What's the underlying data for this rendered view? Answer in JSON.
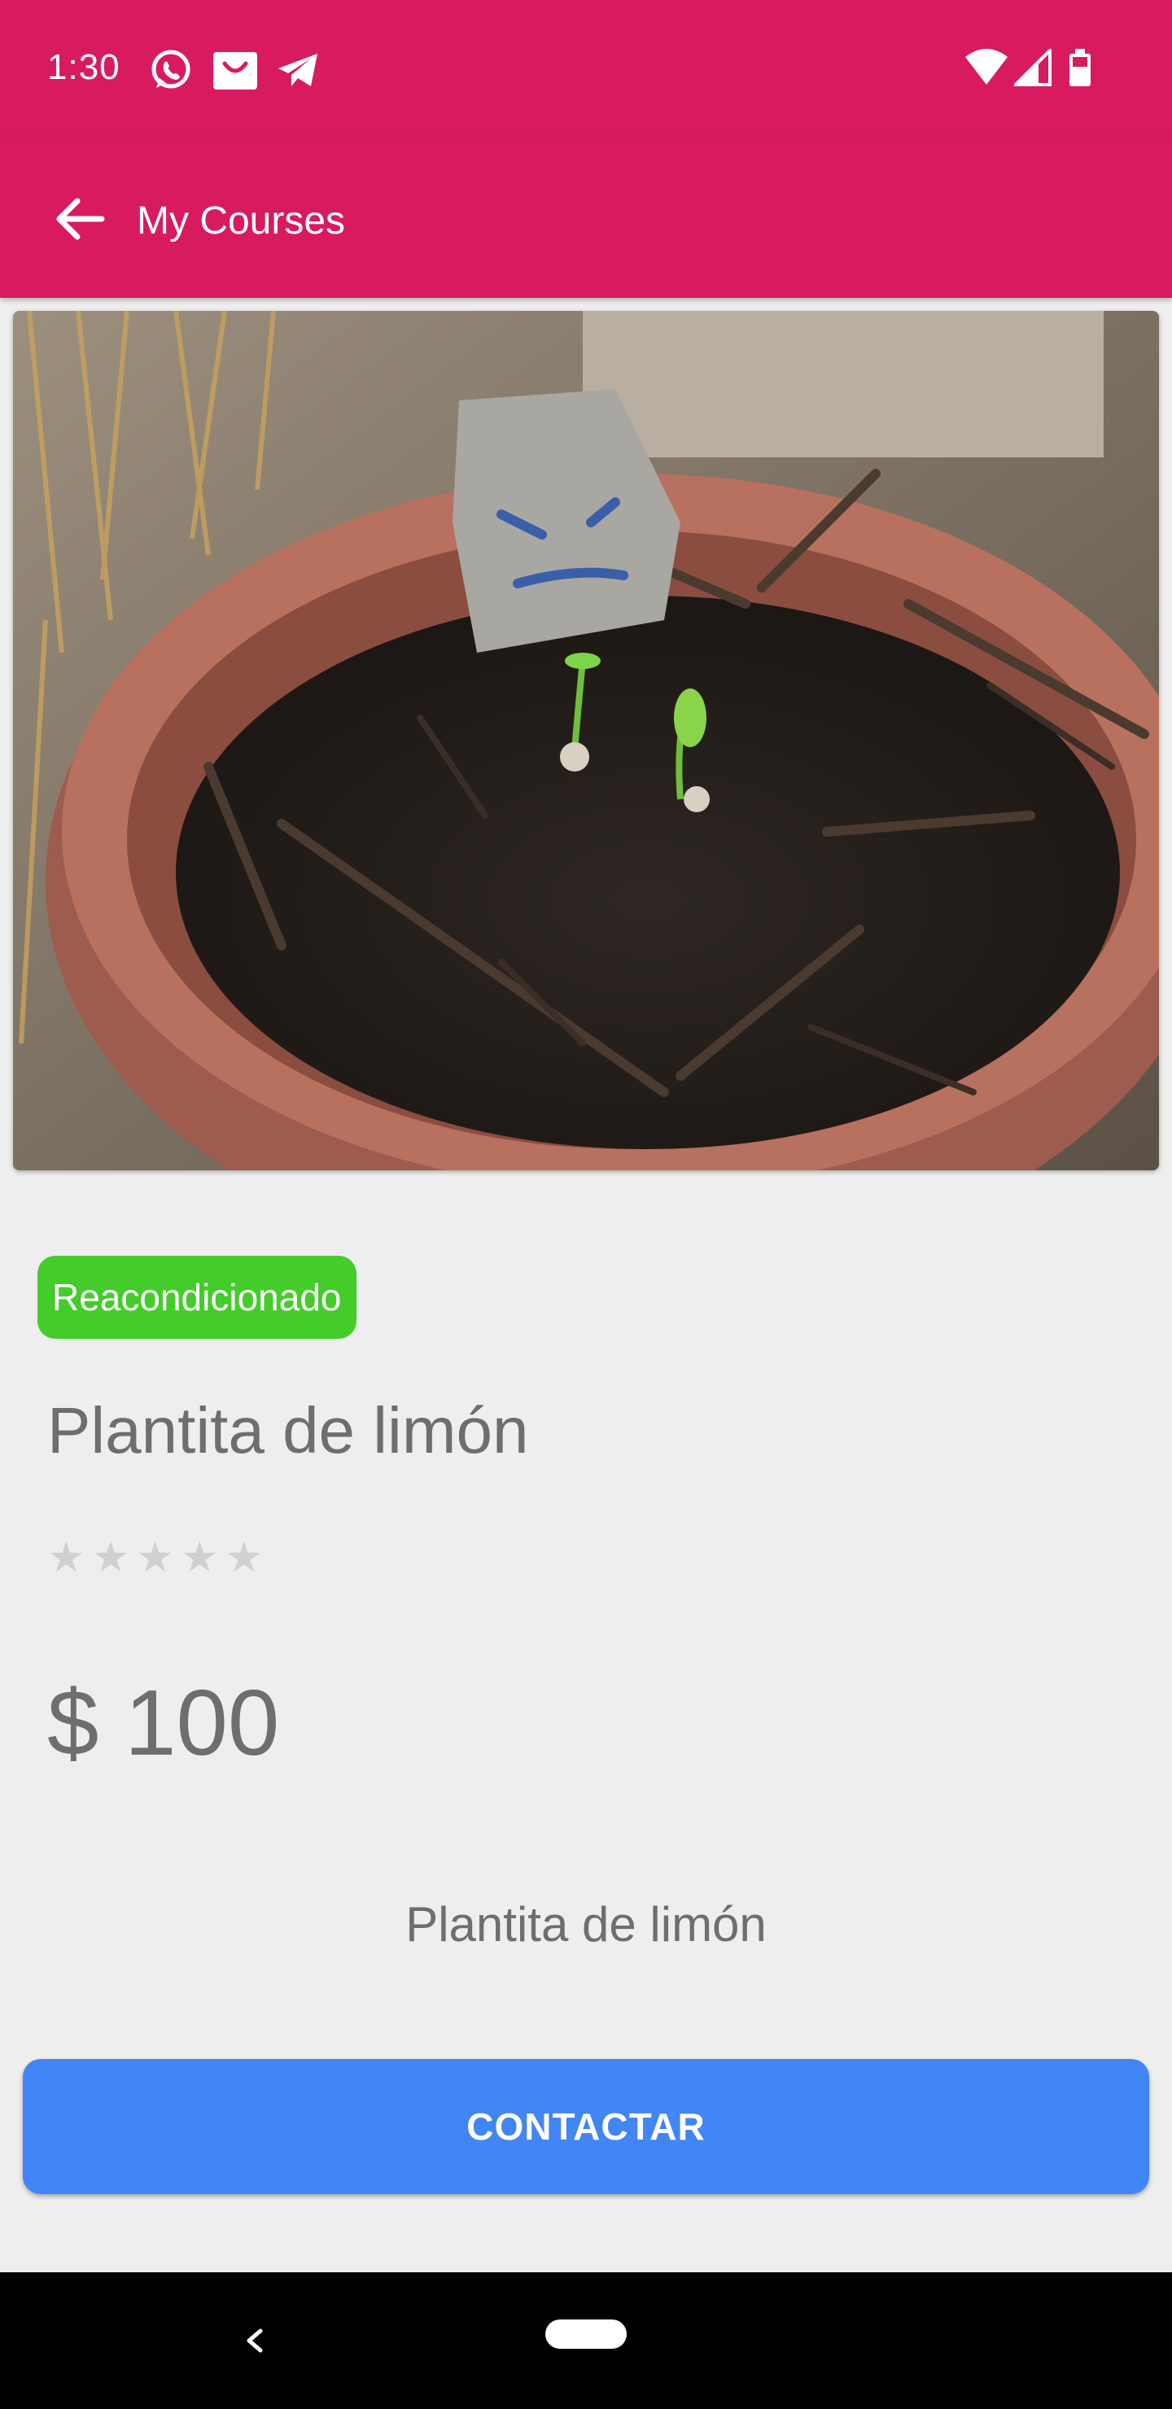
{
  "status_bar": {
    "time": "1:30",
    "left_icons": [
      "whatsapp-icon",
      "bag-icon",
      "telegram-icon"
    ],
    "right_icons": [
      "wifi-icon",
      "signal-icon",
      "battery-icon"
    ]
  },
  "app_bar": {
    "back_icon": "arrow-back-icon",
    "title": "My Courses",
    "color": "#d81b60"
  },
  "product": {
    "image_alt": "potted lemon seedlings",
    "condition": "Reacondicionado",
    "condition_color": "#44cc2b",
    "title": "Plantita de limón",
    "rating": {
      "value": 0,
      "max": 5
    },
    "price": "$ 100",
    "description": "Plantita de limón"
  },
  "actions": {
    "contact_label": "CONTACTAR",
    "contact_color": "#4285f4"
  },
  "nav_bar": {
    "back_icon": "nav-back-icon",
    "home_icon": "nav-home-pill"
  }
}
